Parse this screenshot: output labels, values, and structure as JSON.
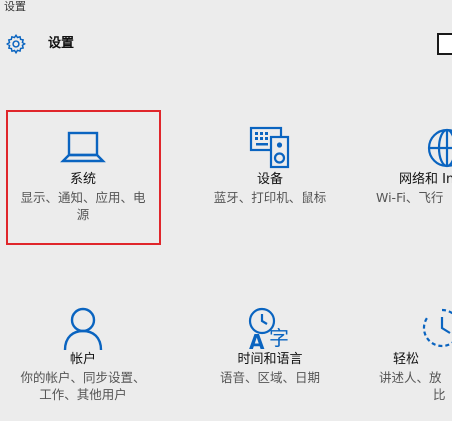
{
  "window": {
    "caption": "设置"
  },
  "header": {
    "title": "设置"
  },
  "tiles": [
    {
      "label": "系统",
      "desc_line1": "显示、通知、应用、电",
      "desc_line2": "源",
      "icon": "laptop-icon"
    },
    {
      "label": "设备",
      "desc_line1": "蓝牙、打印机、鼠标",
      "desc_line2": "",
      "icon": "devices-icon"
    },
    {
      "label": "网络和 In",
      "desc_line1": "Wi-Fi、飞行",
      "desc_line2": "",
      "icon": "globe-icon"
    },
    {
      "label": "帐户",
      "desc_line1": "你的帐户、同步设置、",
      "desc_line2": "工作、其他用户",
      "icon": "person-icon"
    },
    {
      "label": "时间和语言",
      "desc_line1": "语音、区域、日期",
      "desc_line2": "",
      "icon": "time-language-icon"
    },
    {
      "label": "轻松",
      "desc_line1": "讲述人、放",
      "desc_line2": "比",
      "icon": "ease-of-access-icon"
    }
  ],
  "colors": {
    "accent": "#0a64c0",
    "highlight_border": "#e0262b",
    "background": "#ececec"
  }
}
